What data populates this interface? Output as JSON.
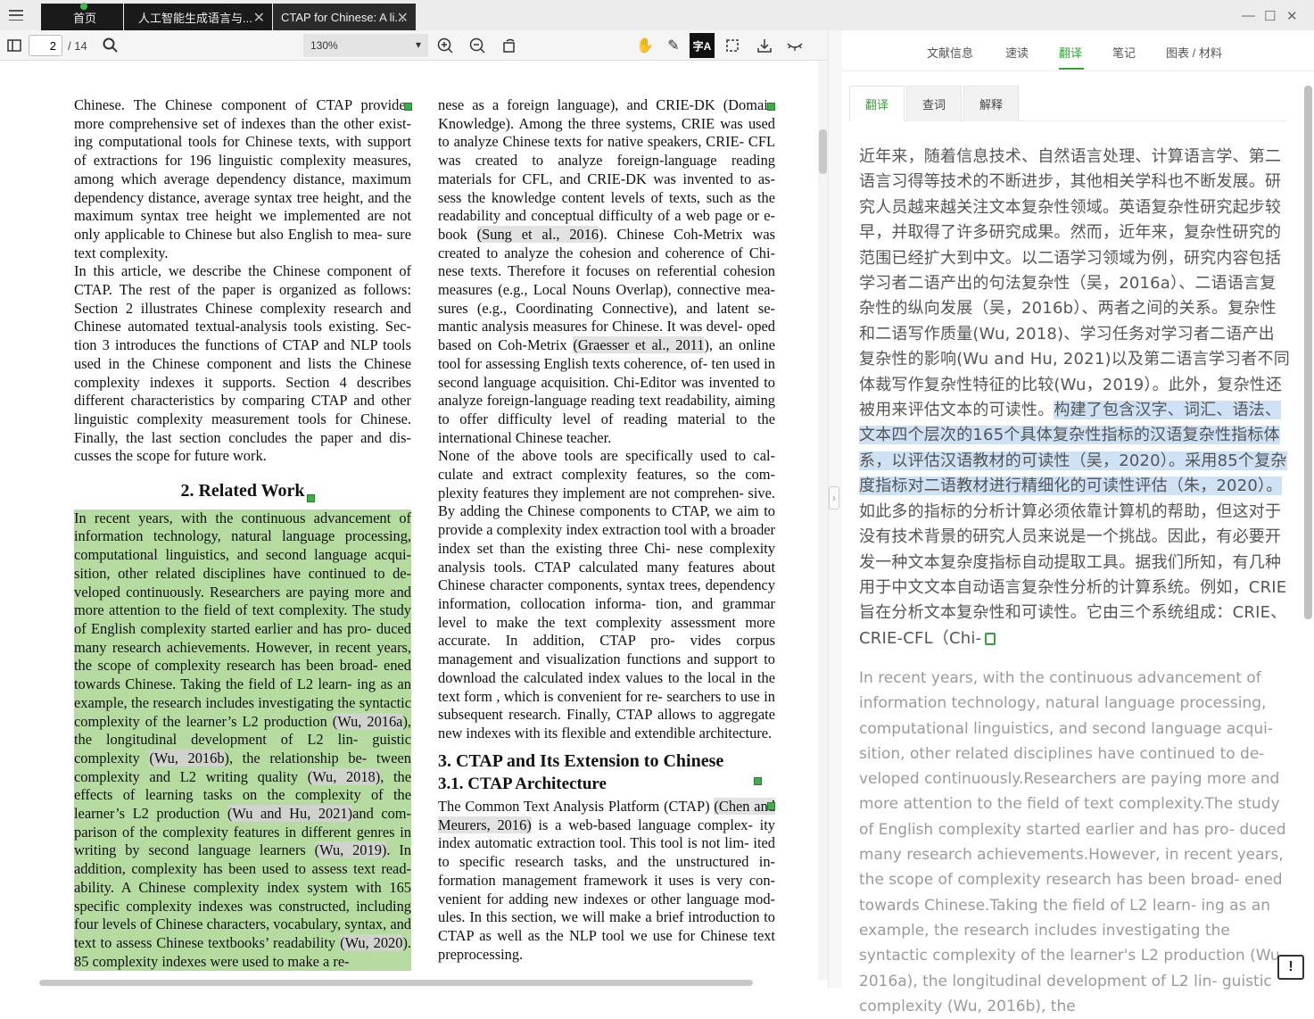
{
  "tabs": [
    {
      "label": "首页"
    },
    {
      "label": "人工智能生成语言与..."
    },
    {
      "label": "CTAP for Chinese: A li..."
    }
  ],
  "toolbar": {
    "page_current": "2",
    "page_total": "/ 14",
    "zoom": "130%",
    "translate_icon_text": "字A"
  },
  "doc": {
    "left_p1": "Chinese. The Chinese component of CTAP provides more comprehensive set of indexes than the other exist- ing computational tools for Chinese texts, with support of extractions for 196 linguistic complexity measures, among which average dependency distance, maximum dependency distance, average syntax tree height, and the maximum syntax tree height we implemented are not only applicable to Chinese but also English to mea- sure text complexity.",
    "left_p2": "In this article, we describe the Chinese component of CTAP. The rest of the paper is organized as follows: Section 2 illustrates Chinese complexity research and Chinese automated textual-analysis tools existing. Sec- tion 3 introduces the functions of CTAP and NLP tools used in the Chinese component and lists the Chinese complexity indexes it supports.  Section 4 describes different characteristics by comparing CTAP and other linguistic complexity measurement tools for Chinese. Finally, the last section concludes the paper and dis- cusses the scope for future work.",
    "sec2_heading": "2.    Related Work",
    "green": {
      "t1": "In recent years, with the continuous advancement of information technology, natural language processing, computational linguistics, and second language acqui- sition, other related disciplines have continued to de- veloped continuously.  Researchers are paying more and more attention to the field of text complexity. The study of English complexity started earlier and has pro- duced many research achievements. However, in recent years, the scope of complexity research has been broad- ened towards Chinese.  Taking the field of L2 learn- ing as an example, the research includes investigating the syntactic complexity of the learner’s L2 production ",
      "c1": "(Wu, 2016a",
      "t2": "), the longitudinal development of L2 lin- guistic complexity ",
      "c2": "(Wu, 2016b",
      "t3": "), the relationship be- tween complexity and L2 writing quality ",
      "c3": "(Wu, 2018)",
      "t4": ", the effects of learning tasks on the complexity of the learner’s L2 production ",
      "c4": "(Wu and Hu, 2021)",
      "t5": "and com- parison of the complexity features in different genres in writing by second language learners ",
      "c5": "(Wu, 2019)",
      "t6": ". In addition, complexity has been used to assess text read- ability.  A Chinese complexity index system with 165 specific complexity indexes was constructed, including four levels of Chinese characters, vocabulary, syntax, and text to assess Chinese textbooks’ readability ",
      "c6": "(Wu, 2020",
      "t7": ").  85 complexity indexes were used to make a re-"
    },
    "right": {
      "r1": "nese as a foreign language), and CRIE-DK (Domain Knowledge). Among the three systems, CRIE was used to analyze Chinese texts for native speakers, CRIE- CFL was created to analyze foreign-language reading materials for CFL, and CRIE-DK was invented to as- sess the knowledge content levels of texts, such as the readability and conceptual difficulty of a web page or e-book ",
      "rc1": "(Sung et al., 2016",
      "r2": ").  Chinese Coh-Metrix was created to analyze the cohesion and coherence of Chi- nese texts. Therefore it focuses on referential cohesion measures (e.g., Local Nouns Overlap), connective mea- sures (e.g., Coordinating Connective), and latent se- mantic analysis measures for Chinese.  It was devel- oped based on Coh-Metrix ",
      "rc2": "(Graesser et al., 2011",
      "r3": "), an online tool for assessing English texts coherence, of- ten used in second language acquisition.  Chi-Editor was invented to analyze foreign-language reading text readability, aiming to offer difficulty level of reading material to the international Chinese teacher.",
      "r_p2": "None of the above tools are specifically used to cal- culate and extract complexity features, so the com- plexity features they implement are not comprehen- sive.  By adding the Chinese components to CTAP, we aim to provide a complexity index extraction tool with a broader index set than the existing three Chi- nese complexity analysis tools. CTAP calculated many features about Chinese character components, syntax trees, dependency information, collocation informa- tion, and grammar level to make the text complexity assessment more accurate.  In addition, CTAP pro- vides corpus management and visualization functions and support to download the calculated index values to the local in the text form , which is convenient for re- searchers to use in subsequent research. Finally, CTAP allows to aggregate new indexes with its flexible and extendible architecture.",
      "sec3_heading": "3.    CTAP and Its Extension to Chinese",
      "sub31_heading": "3.1.    CTAP Architecture",
      "r4": "The Common Text Analysis Platform (CTAP) ",
      "rc3": "(Chen and Meurers, 2016)",
      "r5": " is a web-based language complex- ity index automatic extraction tool. This tool is not lim- ited to specific research tasks, and the unstructured in- formation management framework it uses is very con- venient for adding new indexes or other language mod- ules. In this section, we will make a brief introduction to CTAP as well as the NLP tool we use for Chinese text preprocessing."
    }
  },
  "panel": {
    "tabs": [
      "文献信息",
      "速读",
      "翻译",
      "笔记",
      "图表 / 材料"
    ],
    "subtabs": [
      "翻译",
      "查词",
      "解释"
    ],
    "cn_before": "近年来，随着信息技术、自然语言处理、计算语言学、第二语言习得等技术的不断进步，其他相关学科也不断发展。研究人员越来越关注文本复杂性领域。英语复杂性研究起步较早，并取得了许多研究成果。然而，近年来，复杂性研究的范围已经扩大到中文。以二语学习领域为例，研究内容包括学习者二语产出的句法复杂性（吴，2016a）、二语语言复杂性的纵向发展（吴，2016b）、两者之间的关系。复杂性和二语写作质量(Wu, 2018)、学习任务对学习者二语产出复杂性的影响(Wu and Hu, 2021)以及第二语言学习者不同体裁写作复杂性特征的比较(Wu，2019）。此外，复杂性还被用来评估文本的可读性。",
    "cn_highlight": "构建了包含汉字、词汇、语法、文本四个层次的165个具体复杂性指标的汉语复杂性指标体系，以评估汉语教材的可读性（吴，2020）。采用85个复杂度指标对二语教材进行精细化的可读性评估（朱，2020）。",
    "cn_after": "如此多的指标的分析计算必须依靠计算机的帮助，但这对于没有技术背景的研究人员来说是一个挑战。因此，有必要开发一种文本复杂度指标自动提取工具。据我们所知，有几种用于中文文本自动语言复杂性分析的计算系统。例如，CRIE 旨在分析文本复杂性和可读性。它由三个系统组成：CRIE、CRIE-CFL（Chi-",
    "en_text": "In recent years, with the continuous advancement of information technology, natural language processing, computational linguistics, and second language acqui- sition, other related disciplines have continued to de- veloped continuously.Researchers are paying more and more attention to the field of text complexity.The study of English complexity started earlier and has pro- duced many research achievements.However, in recent years, the scope of complexity research has been broad- ened towards Chinese.Taking the field of L2 learn- ing as an example, the research includes investigating the syntactic complexity of the learner's L2 production (Wu, 2016a), the longitudinal development of L2 lin- guistic complexity (Wu, 2016b), the"
  },
  "colors": {
    "accent": "#3a9d3a",
    "pdf_highlight": "#b6dba0",
    "selection": "#cfe1f5"
  }
}
